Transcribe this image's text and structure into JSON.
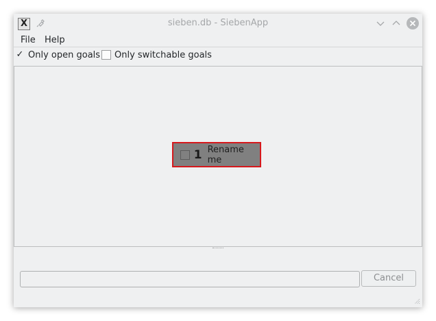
{
  "window": {
    "title": "sieben.db - SiebenApp",
    "app_icon_glyph": "X"
  },
  "menu": {
    "items": [
      "File",
      "Help"
    ]
  },
  "filters": {
    "open_goals": {
      "label": "Only open goals",
      "checked": true,
      "check_glyph": "✓"
    },
    "switchable_goals": {
      "label": "Only switchable goals",
      "checked": false
    }
  },
  "goals": [
    {
      "id": "1",
      "name": "Rename me",
      "selected": true
    }
  ],
  "bottom": {
    "input_value": "",
    "cancel_label": "Cancel"
  },
  "colors": {
    "window_bg": "#eff0f1",
    "goal_bg": "#808080",
    "goal_border": "#d6181c"
  }
}
